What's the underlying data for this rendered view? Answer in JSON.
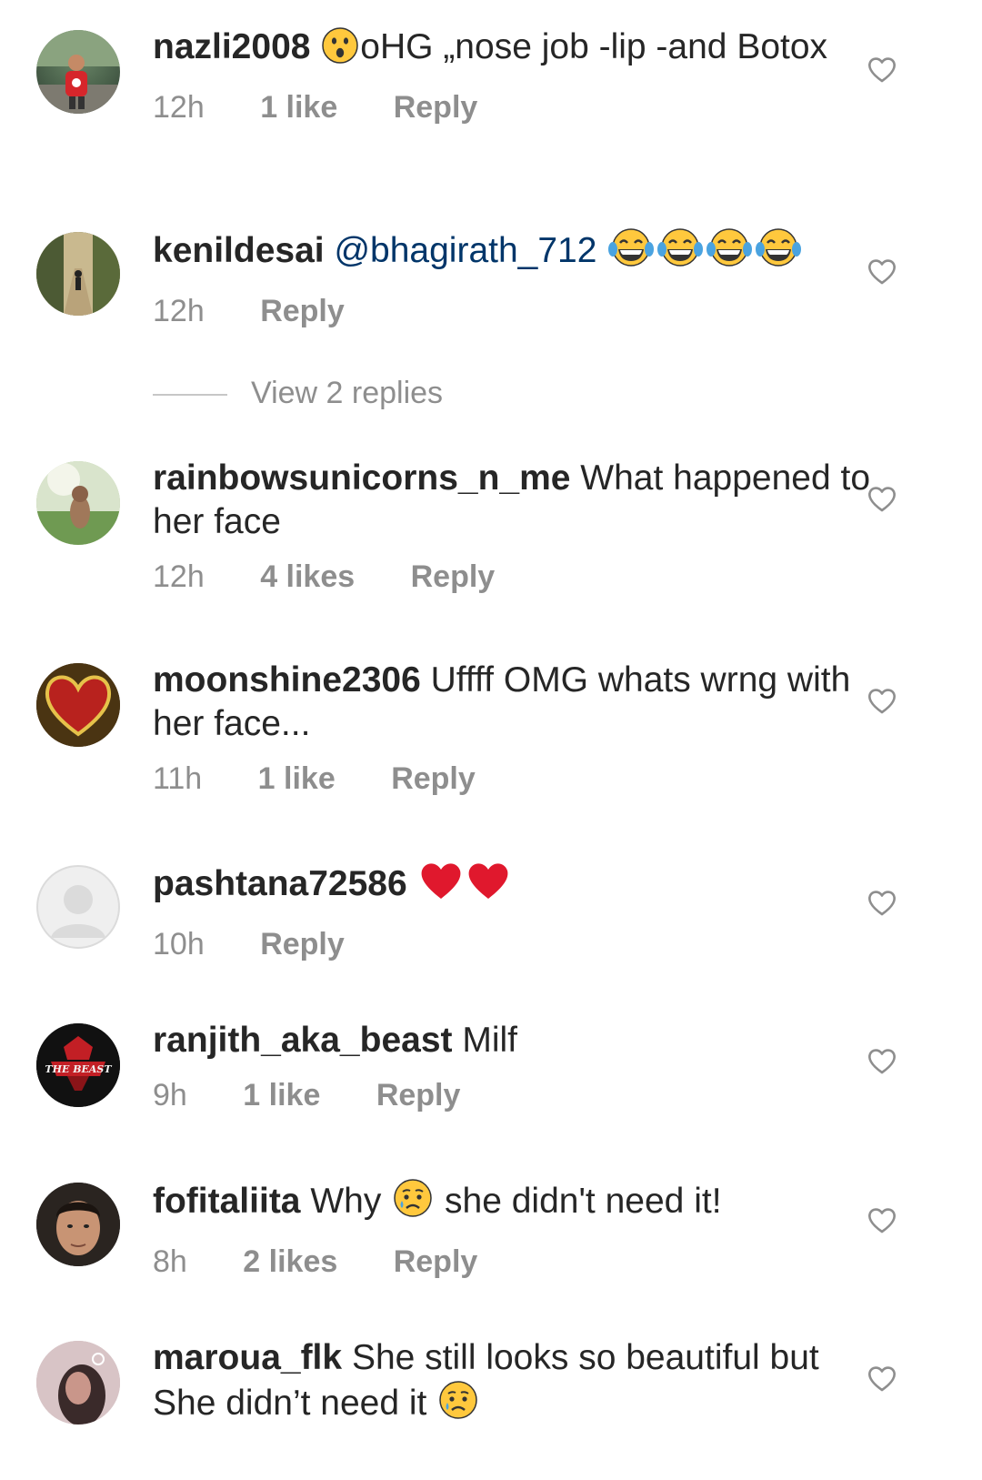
{
  "comments": [
    {
      "username": "nazli2008",
      "emoji_before": "astonished-face",
      "text": "oHG „nose job -lip -and Botox",
      "time": "12h",
      "likes": "1 like",
      "reply": "Reply"
    },
    {
      "username": "kenildesai",
      "mention": "@bhagirath_712",
      "emoji_after": [
        "tears-of-joy-face",
        "tears-of-joy-face",
        "tears-of-joy-face",
        "tears-of-joy-face"
      ],
      "time": "12h",
      "reply": "Reply",
      "view_replies": "View 2 replies"
    },
    {
      "username": "rainbowsunicorns_n_me",
      "text": "What happened to her face",
      "time": "12h",
      "likes": "4 likes",
      "reply": "Reply"
    },
    {
      "username": "moonshine2306",
      "text": "Uffff OMG whats wrng with her face...",
      "time": "11h",
      "likes": "1 like",
      "reply": "Reply"
    },
    {
      "username": "pashtana72586",
      "emoji_after": [
        "red-heart",
        "red-heart"
      ],
      "time": "10h",
      "reply": "Reply"
    },
    {
      "username": "ranjith_aka_beast",
      "text": "Milf",
      "avatar_text": "THE BEAST",
      "time": "9h",
      "likes": "1 like",
      "reply": "Reply"
    },
    {
      "username": "fofitaliita",
      "text_before": "Why",
      "emoji_mid": "crying-face",
      "text_after": "she didn't need it!",
      "time": "8h",
      "likes": "2 likes",
      "reply": "Reply"
    },
    {
      "username": "maroua_flk",
      "text": "She still looks so beautiful but She didn’t need it",
      "emoji_after": [
        "crying-face"
      ]
    }
  ],
  "colors": {
    "text": "#262626",
    "meta": "#8e8e8e",
    "mention": "#003569",
    "heart_outline": "#8e8e8e",
    "heart_emoji": "#e0182d",
    "emoji_yellow": "#ffc83d"
  }
}
